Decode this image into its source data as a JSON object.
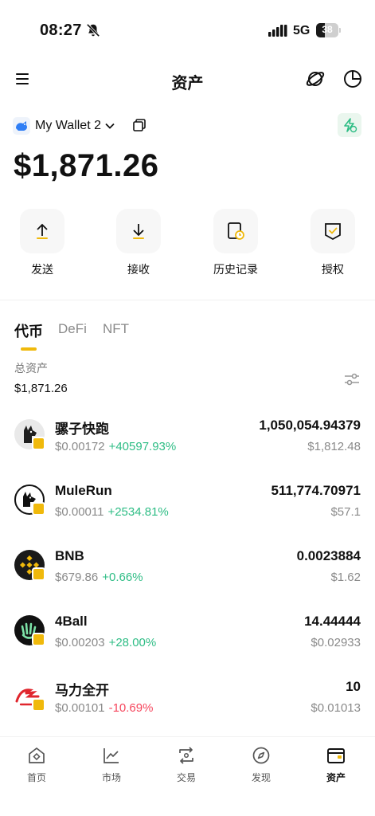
{
  "status_bar": {
    "time": "08:27",
    "network": "5G",
    "battery_level": "38",
    "battery_fraction": 0.38
  },
  "header": {
    "title": "资产",
    "menu_icon": "menu-icon",
    "planet_icon": "planet-icon",
    "pie_icon": "pie-chart-icon"
  },
  "wallet": {
    "name": "My Wallet 2",
    "balance": "$1,871.26",
    "accent_color": "#f0b90b"
  },
  "actions": [
    {
      "label": "发送",
      "icon": "upload-icon"
    },
    {
      "label": "接收",
      "icon": "download-icon"
    },
    {
      "label": "历史记录",
      "icon": "history-icon"
    },
    {
      "label": "授权",
      "icon": "authorize-icon"
    }
  ],
  "tabs": [
    {
      "label": "代币",
      "active": true
    },
    {
      "label": "DeFi",
      "active": false
    },
    {
      "label": "NFT",
      "active": false
    }
  ],
  "summary": {
    "total_label": "总资产",
    "total_value": "$1,871.26"
  },
  "tokens": [
    {
      "name": "骡子快跑",
      "price": "$0.00172",
      "change": "+40597.93%",
      "direction": "up",
      "amount": "1,050,054.94379",
      "usd": "$1,812.48",
      "logo": "mule-run-logo-icon"
    },
    {
      "name": "MuleRun",
      "price": "$0.00011",
      "change": "+2534.81%",
      "direction": "up",
      "amount": "511,774.70971",
      "usd": "$57.1",
      "logo": "mulerun-logo-icon"
    },
    {
      "name": "BNB",
      "price": "$679.86",
      "change": "+0.66%",
      "direction": "up",
      "amount": "0.0023884",
      "usd": "$1.62",
      "logo": "bnb-logo-icon"
    },
    {
      "name": "4Ball",
      "price": "$0.00203",
      "change": "+28.00%",
      "direction": "up",
      "amount": "14.44444",
      "usd": "$0.02933",
      "logo": "4ball-logo-icon"
    },
    {
      "name": "马力全开",
      "price": "$0.00101",
      "change": "-10.69%",
      "direction": "down",
      "amount": "10",
      "usd": "$0.01013",
      "logo": "mali-logo-icon"
    }
  ],
  "bottom_nav": [
    {
      "label": "首页",
      "icon": "home-icon",
      "active": false
    },
    {
      "label": "市场",
      "icon": "market-icon",
      "active": false
    },
    {
      "label": "交易",
      "icon": "trade-icon",
      "active": false
    },
    {
      "label": "发现",
      "icon": "discover-icon",
      "active": false
    },
    {
      "label": "资产",
      "icon": "wallet-icon",
      "active": true
    }
  ]
}
